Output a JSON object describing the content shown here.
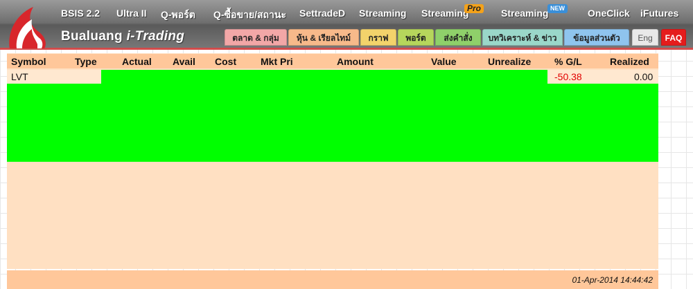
{
  "top_nav": [
    "BSIS 2.2",
    "Ultra II",
    "Q-พอร์ต",
    "Q-ซื้อขาย/สถานะ",
    "SettradeD",
    "Streaming",
    "Streaming",
    "Streaming",
    "OneClick",
    "iFutures"
  ],
  "badges": {
    "pro": "Pro",
    "new": "NEW"
  },
  "brand": {
    "name": "Bualuang",
    "sub": "i-Trading"
  },
  "tabs": [
    {
      "label": "ตลาด & กลุ่ม",
      "color": "#f2a7a7"
    },
    {
      "label": "หุ้น & เรียลไทม์",
      "color": "#f7b98a"
    },
    {
      "label": "กราฟ",
      "color": "#f3d36b"
    },
    {
      "label": "พอร์ต",
      "color": "#b6d65c"
    },
    {
      "label": "ส่งคำสั่ง",
      "color": "#8fd06a"
    },
    {
      "label": "บทวิเคราะห์ & ข่าว",
      "color": "#9ad7c9"
    },
    {
      "label": "ข้อมูลส่วนตัว",
      "color": "#8fc4ee"
    },
    {
      "label": "Eng",
      "color": "#e9e9e9"
    },
    {
      "label": "FAQ",
      "color": "#e51c1c"
    }
  ],
  "columns": [
    "Symbol",
    "Type",
    "Actual",
    "Avail",
    "Cost",
    "Mkt Pri",
    "Amount",
    "Value",
    "Unrealize",
    "% G/L",
    "Realized"
  ],
  "rows": [
    {
      "symbol": "LVT",
      "gl_pct": "-50.38",
      "realized": "0.00"
    }
  ],
  "timestamp": "01-Apr-2014 14:44:42",
  "colors": {
    "highlight": "#00ff00",
    "table_bg": "#ffe0c2",
    "header_bg": "#ffc79a",
    "negative": "#e10000",
    "accent": "#d24b4b"
  }
}
